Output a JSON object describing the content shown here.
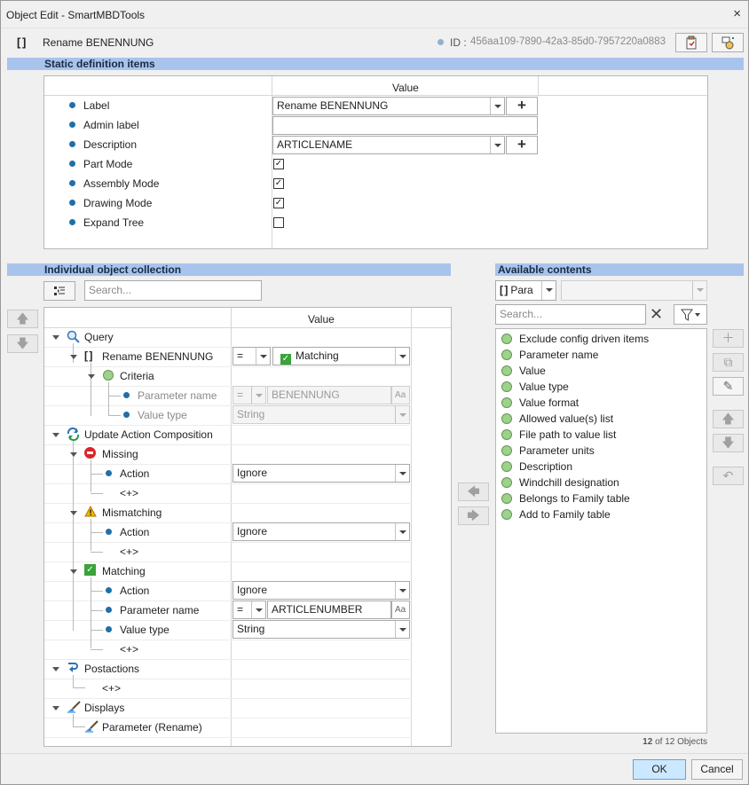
{
  "window": {
    "title": "Object Edit - SmartMBDTools",
    "close_glyph": "×"
  },
  "header": {
    "object_name": "Rename BENENNUNG",
    "id_label": "ID :",
    "id_value": "456aa109-7890-42a3-85d0-7957220a0883"
  },
  "static_section": {
    "title": "Static definition items",
    "value_header": "Value",
    "rows": [
      {
        "label": "Label",
        "value": "Rename BENENNUNG"
      },
      {
        "label": "Admin label",
        "value": ""
      },
      {
        "label": "Description",
        "value": "ARTICLENAME"
      },
      {
        "label": "Part Mode",
        "checked": true
      },
      {
        "label": "Assembly Mode",
        "checked": true
      },
      {
        "label": "Drawing Mode",
        "checked": true
      },
      {
        "label": "Expand Tree",
        "checked": false
      }
    ],
    "plus_glyph": "+"
  },
  "collection": {
    "title": "Individual object collection",
    "search_placeholder": "Search...",
    "value_header": "Value",
    "tree": {
      "query": "Query",
      "rename": "Rename BENENNUNG",
      "rename_op": "=",
      "rename_value": "Matching",
      "criteria": "Criteria",
      "param_name": "Parameter name",
      "param_op": "=",
      "param_value": "BENENNUNG",
      "value_type": "Value type",
      "value_type_value": "String",
      "update": "Update Action Composition",
      "missing": "Missing",
      "action": "Action",
      "ignore": "Ignore",
      "add": "<+>",
      "mismatching": "Mismatching",
      "matching": "Matching",
      "param_name2": "Parameter name",
      "param_op2": "=",
      "param_value2": "ARTICLENUMBER",
      "value_type2": "Value type",
      "value_type2_value": "String",
      "postactions": "Postactions",
      "displays": "Displays",
      "param_rename": "Parameter (Rename)",
      "aa": "Aa"
    }
  },
  "available": {
    "title": "Available contents",
    "type_selector": "Para",
    "search_placeholder": "Search...",
    "items": [
      "Exclude config driven items",
      "Parameter name",
      "Value",
      "Value type",
      "Value format",
      "Allowed value(s) list",
      "File path to value list",
      "Parameter units",
      "Description",
      "Windchill designation",
      "Belongs to Family table",
      "Add to Family table"
    ],
    "count_bold": "12",
    "count_text": " of 12 Objects"
  },
  "footer": {
    "ok": "OK",
    "cancel": "Cancel"
  },
  "colors": {
    "section_bar": "#a8c4ec",
    "dot": "#1f6fa8",
    "ok_button": "#cce8ff"
  }
}
